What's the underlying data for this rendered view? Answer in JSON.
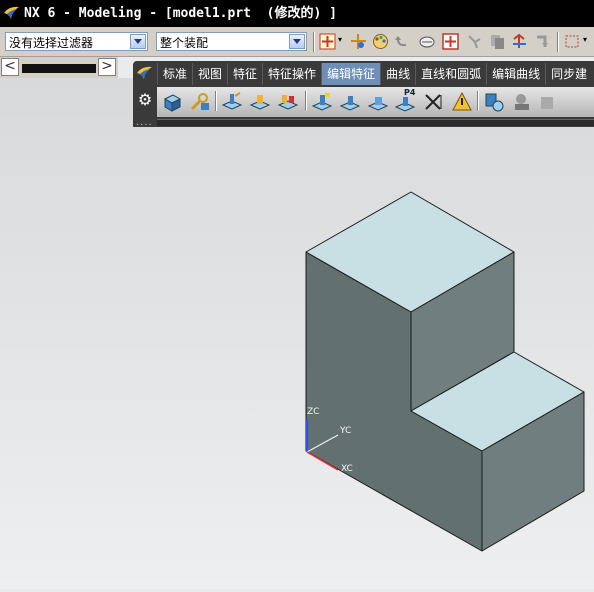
{
  "window": {
    "title": "NX 6 - Modeling - [model1.prt  (修改的) ]"
  },
  "selection_bar": {
    "filter_value": "没有选择过滤器",
    "scope_value": "整个装配"
  },
  "scroll": {
    "left": "<",
    "right": ">"
  },
  "toolbar": {
    "tabs": [
      {
        "label": "标准"
      },
      {
        "label": "视图"
      },
      {
        "label": "特征"
      },
      {
        "label": "特征操作"
      },
      {
        "label": "编辑特征",
        "active": true
      },
      {
        "label": "曲线"
      },
      {
        "label": "直线和圆弧"
      },
      {
        "label": "编辑曲线"
      },
      {
        "label": "同步建"
      }
    ],
    "icon_names": [
      "block-icon",
      "feature-params-icon",
      "edit-position-icon",
      "move-feature-icon",
      "reorder-feature-icon",
      "replace-feature-icon",
      "suppress-feature-icon",
      "unsuppress-feature-icon",
      "p4-replay-icon",
      "remove-params-icon",
      "delayed-update-icon",
      "playback-icon",
      "solid-density-icon"
    ],
    "p4_label": "P4"
  },
  "csys": {
    "zc": "ZC",
    "yc": "YC",
    "xc": "XC"
  },
  "colors": {
    "face_top": "#c8dfe4",
    "face_front": "#627170",
    "face_right": "#707e80",
    "edge": "#1a1a1a",
    "active_tab": "#6d8fb6"
  }
}
